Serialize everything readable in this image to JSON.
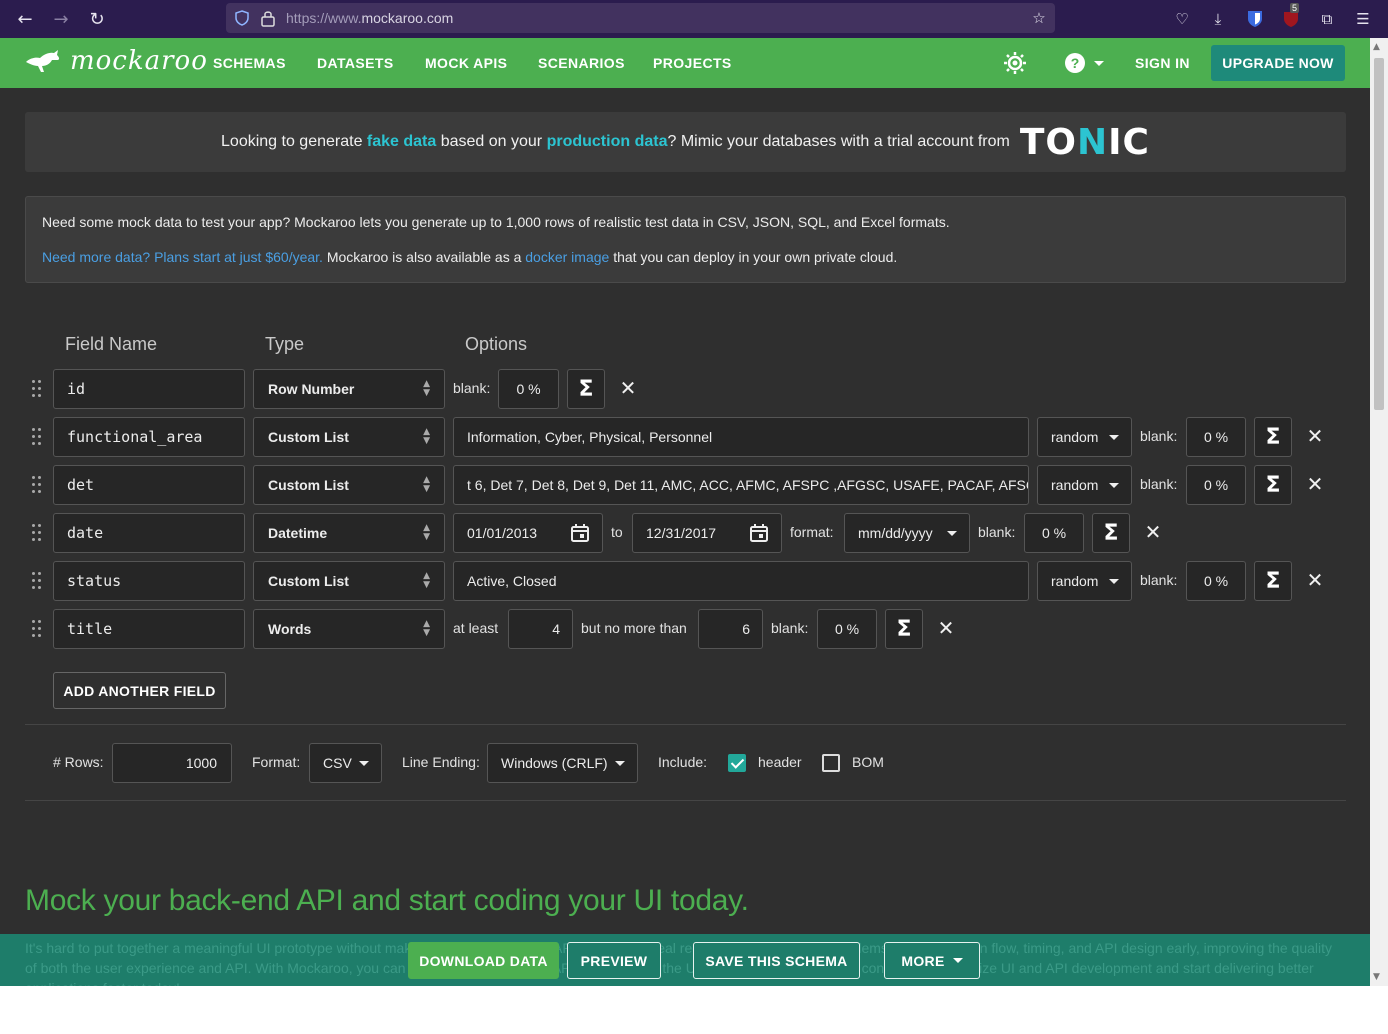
{
  "browser": {
    "url_prefix": "https://www.",
    "url_domain": "mockaroo.com",
    "ublock_badge": "5"
  },
  "nav": {
    "logo": "mockaroo",
    "items": [
      "SCHEMAS",
      "DATASETS",
      "MOCK APIS",
      "SCENARIOS",
      "PROJECTS"
    ],
    "sign_in": "SIGN IN",
    "upgrade": "UPGRADE NOW"
  },
  "tonic_banner": {
    "part1": "Looking to generate ",
    "hl1": "fake data",
    "part2": " based on your ",
    "hl2": "production data",
    "part3": "? Mimic your databases with a trial account from",
    "logo_a": "TO",
    "logo_n": "N",
    "logo_b": "IC"
  },
  "info": {
    "line1": "Need some mock data to test your app? Mockaroo lets you generate up to 1,000 rows of realistic test data in CSV, JSON, SQL, and Excel formats.",
    "link1": "Need more data? Plans start at just $60/year.",
    "mid": " Mockaroo is also available as a ",
    "link2": "docker image",
    "end": " that you can deploy in your own private cloud."
  },
  "columns": {
    "field_name": "Field Name",
    "type": "Type",
    "options": "Options"
  },
  "fields": [
    {
      "name": "id",
      "type": "Row Number",
      "blank": "0 %"
    },
    {
      "name": "functional_area",
      "type": "Custom List",
      "values": "Information, Cyber, Physical, Personnel",
      "order": "random",
      "blank": "0 %"
    },
    {
      "name": "det",
      "type": "Custom List",
      "values": "t 6, Det 7, Det 8, Det 9, Det 11, AMC, ACC, AFMC, AFSPC ,AFGSC, USAFE, PACAF, AFSOC",
      "order": "random",
      "blank": "0 %"
    },
    {
      "name": "date",
      "type": "Datetime",
      "from": "01/01/2013",
      "to_label": "to",
      "to": "12/31/2017",
      "format_label": "format:",
      "format": "mm/dd/yyyy",
      "blank": "0 %"
    },
    {
      "name": "status",
      "type": "Custom List",
      "values": "Active, Closed",
      "order": "random",
      "blank": "0 %"
    },
    {
      "name": "title",
      "type": "Words",
      "at_least_label": "at least",
      "at_least": "4",
      "no_more_label": "but no more than",
      "no_more": "6",
      "blank": "0 %"
    }
  ],
  "labels": {
    "blank": "blank:",
    "add_field": "ADD ANOTHER FIELD",
    "rows": "# Rows:",
    "format": "Format:",
    "line_ending": "Line Ending:",
    "include": "Include:",
    "header": "header",
    "bom": "BOM"
  },
  "options": {
    "rows": "1000",
    "format": "CSV",
    "line_ending": "Windows (CRLF)",
    "header_checked": true,
    "bom_checked": false
  },
  "promo": {
    "heading": "Mock your back-end API and start coding your UI today.",
    "body": "It's hard to put together a meaningful UI prototype without making real requests to an API. By making real requests, you'll uncover problems with application flow, timing, and API design early, improving the quality of both the user experience and API. With Mockaroo, you can design your own mock APIs, You control the URLs, responses, and error conditions. Paralellize UI and API development and start delivering better applications faster today!"
  },
  "actions": {
    "download": "DOWNLOAD DATA",
    "preview": "PREVIEW",
    "save": "SAVE THIS SCHEMA",
    "more": "MORE"
  },
  "colors": {
    "brand_green": "#4caf50",
    "teal": "#1e8a7a",
    "highlight": "#2cc4d1",
    "link": "#4a9fe3",
    "page_bg": "#2f2f2f"
  }
}
